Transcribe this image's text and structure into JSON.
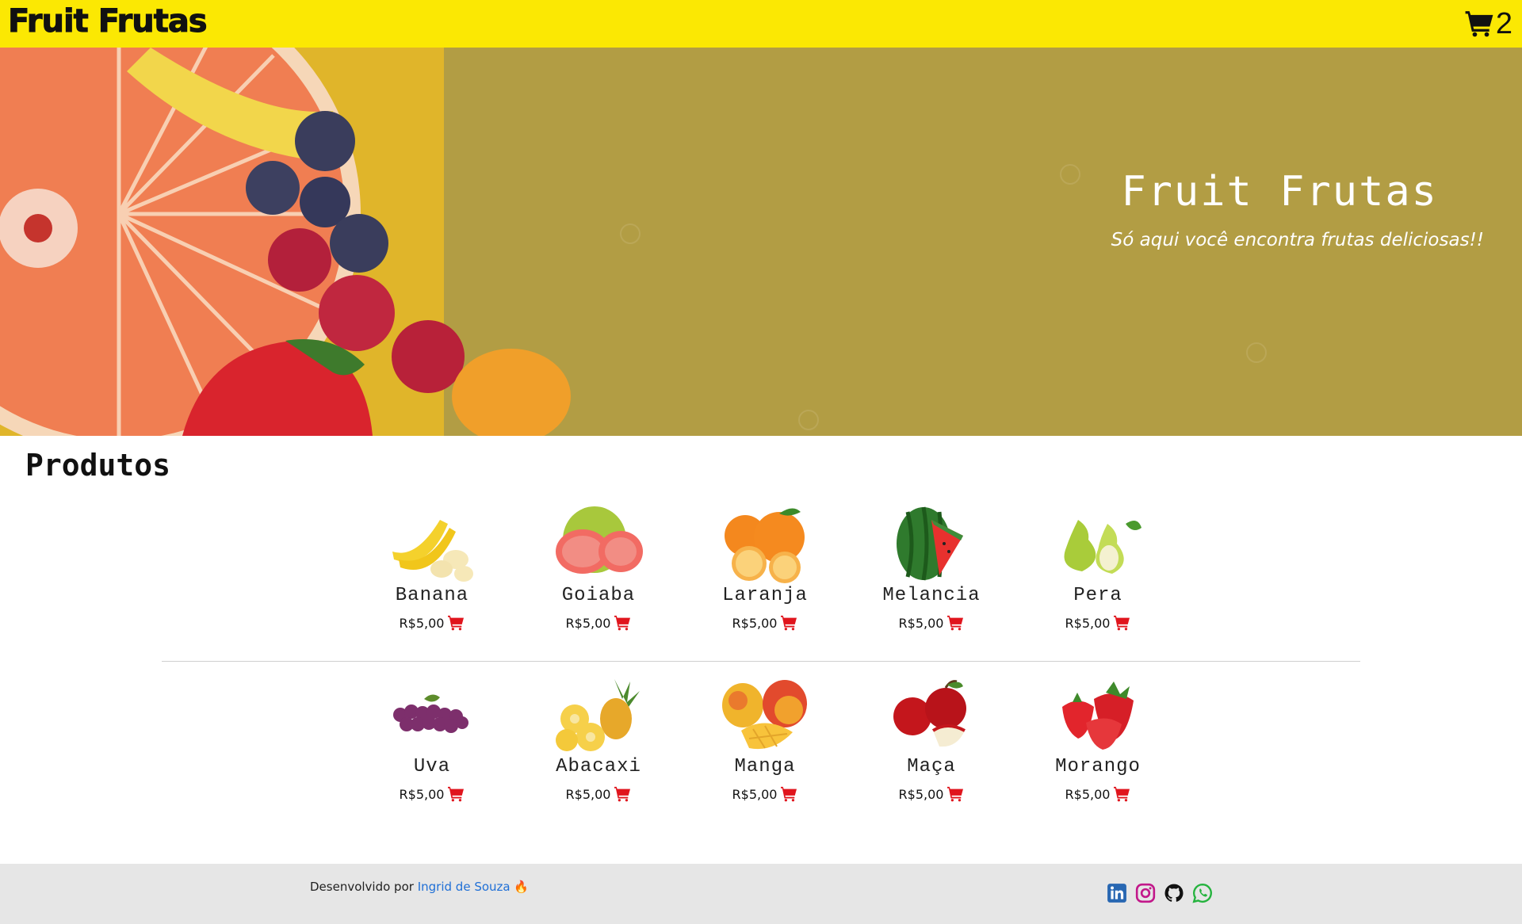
{
  "header": {
    "brand": "Fruit Frutas",
    "cart_count": "2"
  },
  "hero": {
    "title": "Fruit Frutas",
    "subtitle": "Só aqui você encontra frutas deliciosas!!"
  },
  "products": {
    "heading": "Produtos",
    "row1": [
      {
        "name": "Banana",
        "price": "R$5,00",
        "icon": "banana-icon"
      },
      {
        "name": "Goiaba",
        "price": "R$5,00",
        "icon": "guava-icon"
      },
      {
        "name": "Laranja",
        "price": "R$5,00",
        "icon": "orange-icon"
      },
      {
        "name": "Melancia",
        "price": "R$5,00",
        "icon": "watermelon-icon"
      },
      {
        "name": "Pera",
        "price": "R$5,00",
        "icon": "pear-icon"
      }
    ],
    "row2": [
      {
        "name": "Uva",
        "price": "R$5,00",
        "icon": "grapes-icon"
      },
      {
        "name": "Abacaxi",
        "price": "R$5,00",
        "icon": "pineapple-icon"
      },
      {
        "name": "Manga",
        "price": "R$5,00",
        "icon": "mango-icon"
      },
      {
        "name": "Maça",
        "price": "R$5,00",
        "icon": "apple-icon"
      },
      {
        "name": "Morango",
        "price": "R$5,00",
        "icon": "strawberry-icon"
      }
    ]
  },
  "footer": {
    "credit_prefix": "Desenvolvido por",
    "credit_author": "Ingrid de Souza",
    "credit_emoji": "🔥",
    "socials": [
      "linkedin-icon",
      "instagram-icon",
      "github-icon",
      "whatsapp-icon"
    ]
  },
  "colors": {
    "header_bg": "#fbe803",
    "hero_bg": "#b29d44",
    "cart_red": "#e0151d",
    "footer_bg": "#e6e6e6",
    "link": "#1f6fd6"
  }
}
